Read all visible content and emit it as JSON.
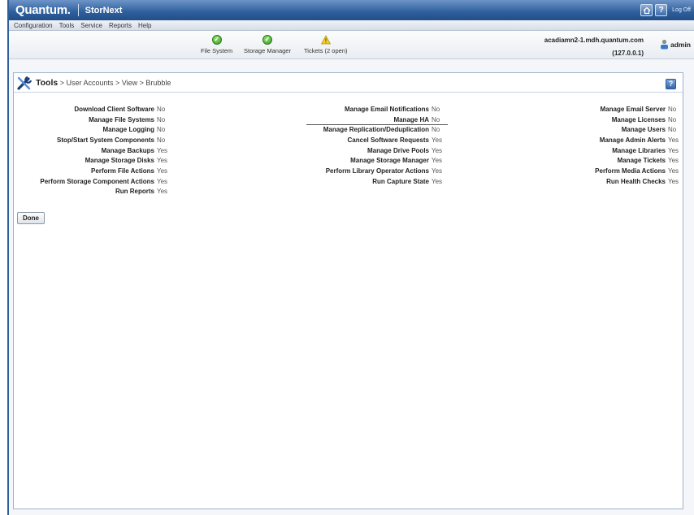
{
  "app": {
    "brand": "Quantum.",
    "product": "StorNext",
    "logoff_label": "Log Off"
  },
  "menu": [
    "Configuration",
    "Tools",
    "Service",
    "Reports",
    "Help"
  ],
  "status": [
    {
      "label": "File System",
      "state": "ok"
    },
    {
      "label": "Storage Manager",
      "state": "ok"
    },
    {
      "label": "Tickets (2 open)",
      "state": "warning"
    }
  ],
  "host": {
    "name": "acadiamn2-1.mdh.quantum.com",
    "ip": "(127.0.0.1)"
  },
  "user": {
    "name": "admin"
  },
  "breadcrumb": {
    "root": "Tools",
    "path": " > User Accounts > View > Brubble"
  },
  "permissions": {
    "col1": [
      {
        "label": "Download Client Software",
        "value": "No"
      },
      {
        "label": "Manage File Systems",
        "value": "No"
      },
      {
        "label": "Manage Logging",
        "value": "No"
      },
      {
        "label": "Stop/Start System Components",
        "value": "No"
      },
      {
        "label": "Manage Backups",
        "value": "Yes"
      },
      {
        "label": "Manage Storage Disks",
        "value": "Yes"
      },
      {
        "label": "Perform File Actions",
        "value": "Yes"
      },
      {
        "label": "Perform Storage Component Actions",
        "value": "Yes"
      },
      {
        "label": "Run Reports",
        "value": "Yes"
      }
    ],
    "col2": [
      {
        "label": "Manage Email Notifications",
        "value": "No"
      },
      {
        "label": "Manage HA",
        "value": "No"
      },
      {
        "label": "Manage Replication/Deduplication",
        "value": "No"
      },
      {
        "label": "Cancel Software Requests",
        "value": "Yes"
      },
      {
        "label": "Manage Drive Pools",
        "value": "Yes"
      },
      {
        "label": "Manage Storage Manager",
        "value": "Yes"
      },
      {
        "label": "Perform Library Operator Actions",
        "value": "Yes"
      },
      {
        "label": "Run Capture State",
        "value": "Yes"
      }
    ],
    "col3": [
      {
        "label": "Manage Email Server",
        "value": "No"
      },
      {
        "label": "Manage Licenses",
        "value": "No"
      },
      {
        "label": "Manage Users",
        "value": "No"
      },
      {
        "label": "Manage Admin Alerts",
        "value": "Yes"
      },
      {
        "label": "Manage Libraries",
        "value": "Yes"
      },
      {
        "label": "Manage Tickets",
        "value": "Yes"
      },
      {
        "label": "Perform Media Actions",
        "value": "Yes"
      },
      {
        "label": "Run Health Checks",
        "value": "Yes"
      }
    ]
  },
  "actions": {
    "done_label": "Done"
  },
  "icons": {
    "home": "home-icon",
    "help": "help-icon",
    "ok": "check-circle-icon",
    "warning": "warning-triangle-icon",
    "user": "user-icon",
    "tools": "wrench-screwdriver-icon"
  },
  "colors": {
    "header": "#2e5f9c",
    "ok": "#2f9a1c",
    "warning": "#f2c200"
  }
}
